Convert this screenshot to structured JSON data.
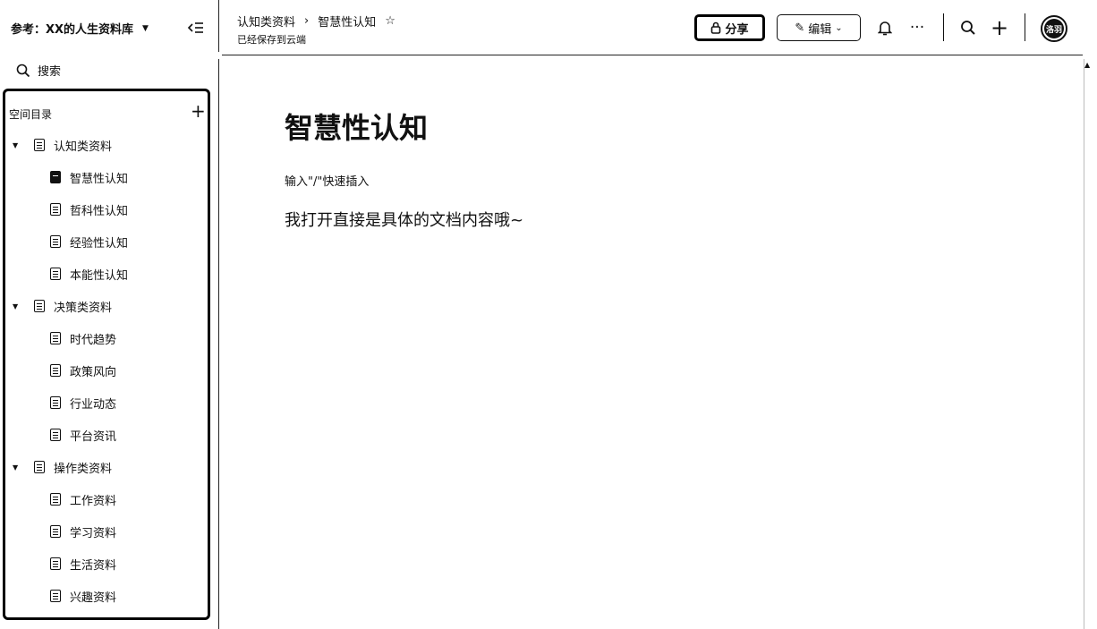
{
  "sidebar": {
    "space_title": "参考：XX的人生资料库",
    "search_label": "搜索",
    "tree_heading": "空间目录",
    "groups": [
      {
        "label": "认知类资料",
        "children": [
          "智慧性认知",
          "哲科性认知",
          "经验性认知",
          "本能性认知"
        ]
      },
      {
        "label": "决策类资料",
        "children": [
          "时代趋势",
          "政策风向",
          "行业动态",
          "平台资讯"
        ]
      },
      {
        "label": "操作类资料",
        "children": [
          "工作资料",
          "学习资料",
          "生活资料",
          "兴趣资料"
        ]
      }
    ],
    "active_item": "智慧性认知"
  },
  "header": {
    "breadcrumb_parent": "认知类资料",
    "breadcrumb_current": "智慧性认知",
    "save_status": "已经保存到云端",
    "share_label": "分享",
    "edit_label": "编辑",
    "avatar_text": "洛羽"
  },
  "document": {
    "title": "智慧性认知",
    "hint": "输入\"/\"快速插入",
    "body": "我打开直接是具体的文档内容哦~"
  },
  "icons": {
    "collapse": "collapse-sidebar-icon",
    "search": "search-icon",
    "add": "plus-icon",
    "doc": "document-icon",
    "star": "star-icon",
    "bell": "bell-icon",
    "more": "more-icon"
  }
}
